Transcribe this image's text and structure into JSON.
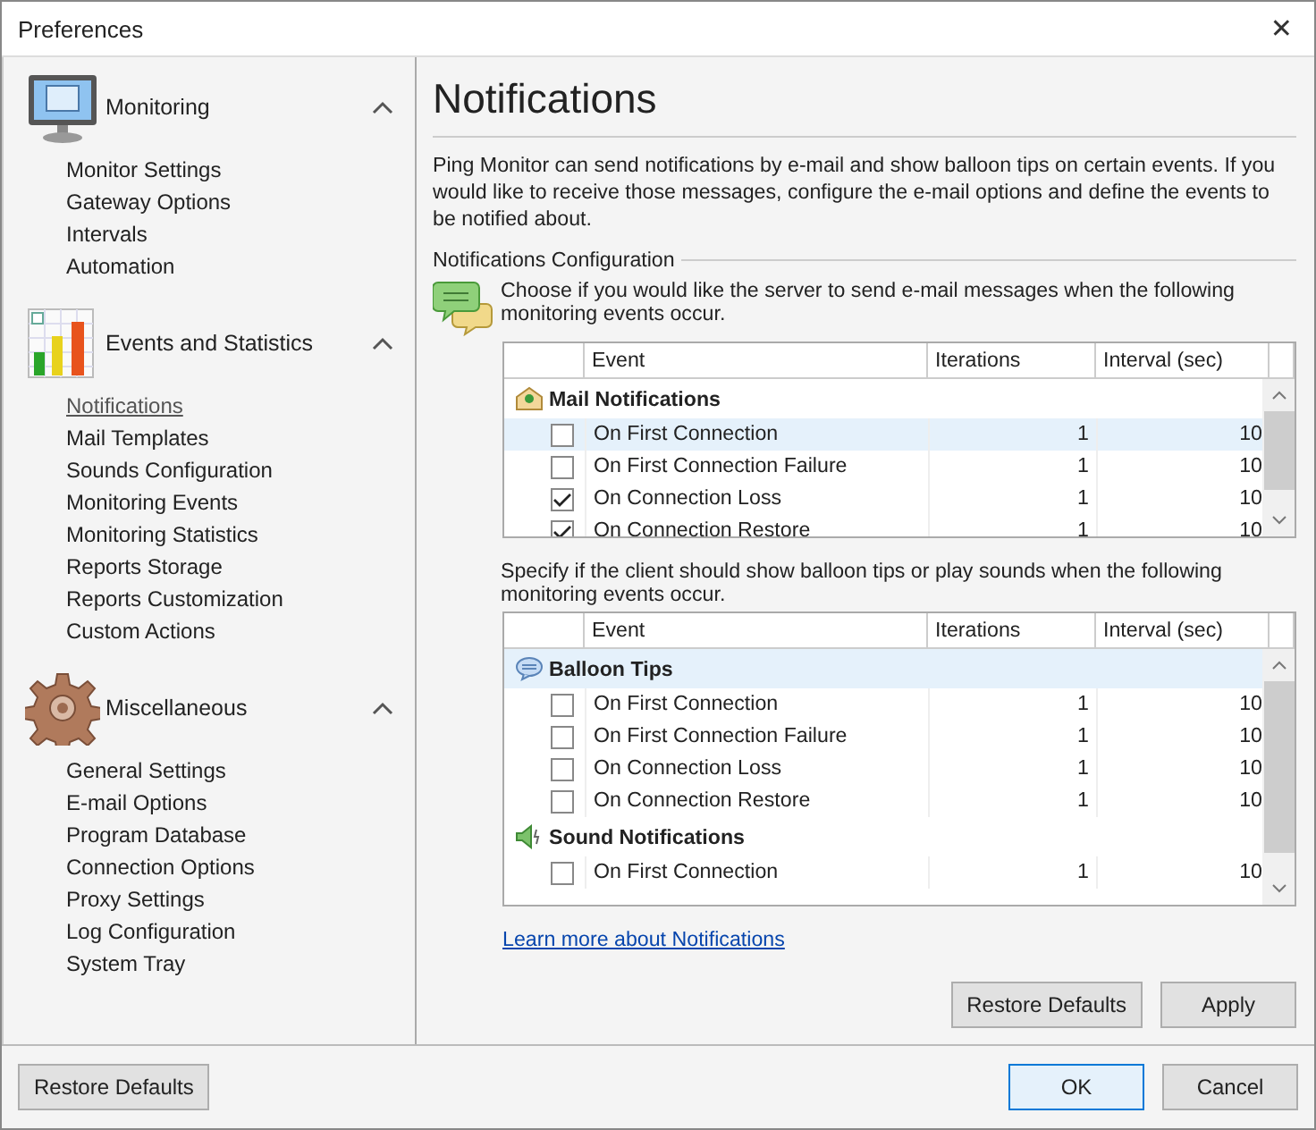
{
  "window": {
    "title": "Preferences",
    "close": "✕"
  },
  "sidebar": {
    "sections": [
      {
        "title": "Monitoring",
        "expanded": true,
        "items": [
          {
            "label": "Monitor Settings",
            "selected": false
          },
          {
            "label": "Gateway Options",
            "selected": false
          },
          {
            "label": "Intervals",
            "selected": false
          },
          {
            "label": "Automation",
            "selected": false
          }
        ]
      },
      {
        "title": "Events and Statistics",
        "expanded": true,
        "items": [
          {
            "label": "Notifications",
            "selected": true
          },
          {
            "label": "Mail Templates",
            "selected": false
          },
          {
            "label": "Sounds Configuration",
            "selected": false
          },
          {
            "label": "Monitoring Events",
            "selected": false
          },
          {
            "label": "Monitoring Statistics",
            "selected": false
          },
          {
            "label": "Reports Storage",
            "selected": false
          },
          {
            "label": "Reports Customization",
            "selected": false
          },
          {
            "label": "Custom Actions",
            "selected": false
          }
        ]
      },
      {
        "title": "Miscellaneous",
        "expanded": true,
        "items": [
          {
            "label": "General Settings",
            "selected": false
          },
          {
            "label": "E-mail Options",
            "selected": false
          },
          {
            "label": "Program Database",
            "selected": false
          },
          {
            "label": "Connection Options",
            "selected": false
          },
          {
            "label": "Proxy Settings",
            "selected": false
          },
          {
            "label": "Log Configuration",
            "selected": false
          },
          {
            "label": "System Tray",
            "selected": false
          }
        ]
      }
    ]
  },
  "main": {
    "heading": "Notifications",
    "intro": "Ping Monitor can send notifications by e-mail and show balloon tips on certain events. If you would like to receive those messages, configure the e-mail options and define the events to be notified about.",
    "group_title": "Notifications Configuration",
    "grids": [
      {
        "description": "Choose if you would like the server to send e-mail messages when the following monitoring events occur.",
        "columns": [
          "Event",
          "Iterations",
          "Interval (sec)"
        ],
        "groups": [
          {
            "label": "Mail Notifications",
            "selected": false,
            "rows": [
              {
                "event": "On First Connection",
                "iterations": "1",
                "interval": "10",
                "checked": false,
                "selected": true
              },
              {
                "event": "On First Connection Failure",
                "iterations": "1",
                "interval": "10",
                "checked": false,
                "selected": false
              },
              {
                "event": "On Connection Loss",
                "iterations": "1",
                "interval": "10",
                "checked": true,
                "selected": false
              },
              {
                "event": "On Connection Restore",
                "iterations": "1",
                "interval": "10",
                "checked": true,
                "selected": false
              }
            ]
          }
        ]
      },
      {
        "description": "Specify if the client should show balloon tips or play sounds when the following monitoring events occur.",
        "columns": [
          "Event",
          "Iterations",
          "Interval (sec)"
        ],
        "groups": [
          {
            "label": "Balloon Tips",
            "selected": true,
            "rows": [
              {
                "event": "On First Connection",
                "iterations": "1",
                "interval": "10",
                "checked": false,
                "selected": false
              },
              {
                "event": "On First Connection Failure",
                "iterations": "1",
                "interval": "10",
                "checked": false,
                "selected": false
              },
              {
                "event": "On Connection Loss",
                "iterations": "1",
                "interval": "10",
                "checked": false,
                "selected": false
              },
              {
                "event": "On Connection Restore",
                "iterations": "1",
                "interval": "10",
                "checked": false,
                "selected": false
              }
            ]
          },
          {
            "label": "Sound Notifications",
            "selected": false,
            "rows": [
              {
                "event": "On First Connection",
                "iterations": "1",
                "interval": "10",
                "checked": false,
                "selected": false
              }
            ]
          }
        ]
      }
    ],
    "link": "Learn more about Notifications",
    "buttons": [
      "Restore Defaults",
      "Apply"
    ]
  },
  "footer": {
    "left_button": "Restore Defaults",
    "buttons": [
      "OK",
      "Cancel"
    ]
  }
}
